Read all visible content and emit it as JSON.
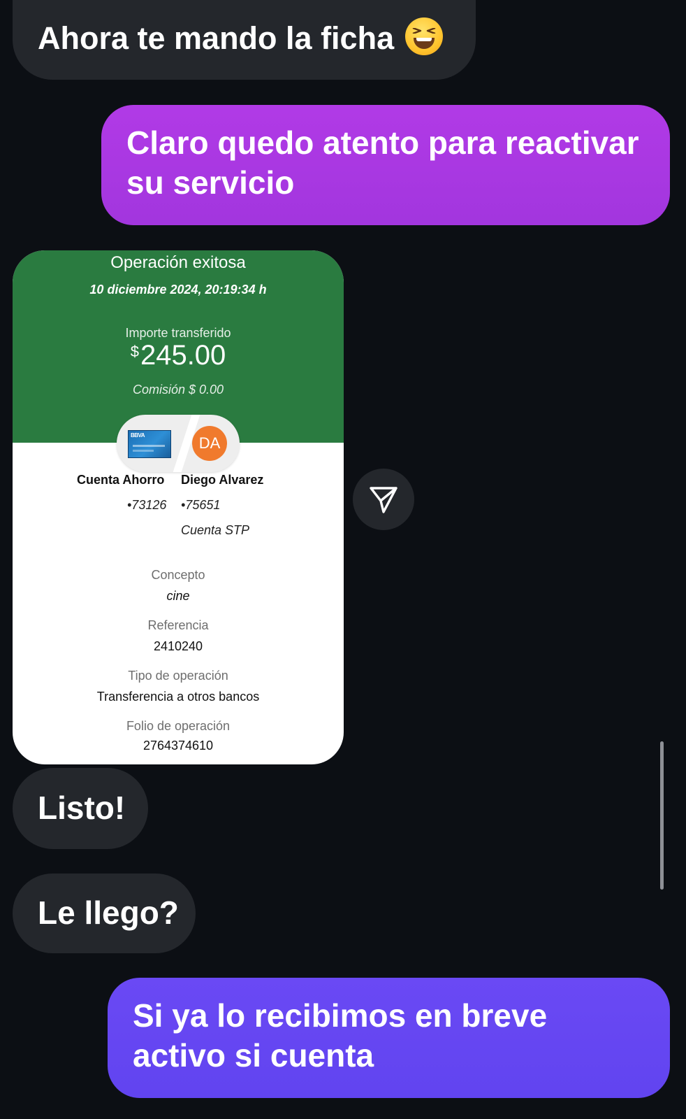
{
  "messages": {
    "m1": {
      "text": "Ahora te mando la ficha",
      "emoji": "grinning-squinting-face-icon"
    },
    "m2": {
      "text": "Claro quedo atento para reactivar su servicio"
    },
    "m4": {
      "text": "Listo!"
    },
    "m5": {
      "text": "Le llego?"
    },
    "m6": {
      "text": "Si ya lo recibimos en breve activo si cuenta"
    }
  },
  "receipt": {
    "title": "Operación exitosa",
    "date": "10 diciembre 2024, 20:19:34 h",
    "amount_label": "Importe transferido",
    "currency": "$",
    "amount": "245.00",
    "fee": "Comisión  $ 0.00",
    "card_logo": "BBVA",
    "avatar_initials": "DA",
    "from": {
      "name": "Cuenta Ahorro",
      "number": "•73126"
    },
    "to": {
      "name": "Diego Alvarez",
      "number": "•75651",
      "type": "Cuenta STP"
    },
    "concept_label": "Concepto",
    "concept": "cine",
    "reference_label": "Referencia",
    "reference": "2410240",
    "op_type_label": "Tipo de operación",
    "op_type": "Transferencia a otros bancos",
    "folio_label": "Folio de operación",
    "folio": "2764374610"
  },
  "colors": {
    "background": "#0c0f14",
    "incoming_bubble": "#24272c",
    "outgoing_purple": "#a236de",
    "outgoing_violet": "#6144f0",
    "receipt_green": "#2a7b40",
    "avatar_orange": "#f07a2d"
  },
  "icons": {
    "send": "paper-plane-icon"
  }
}
